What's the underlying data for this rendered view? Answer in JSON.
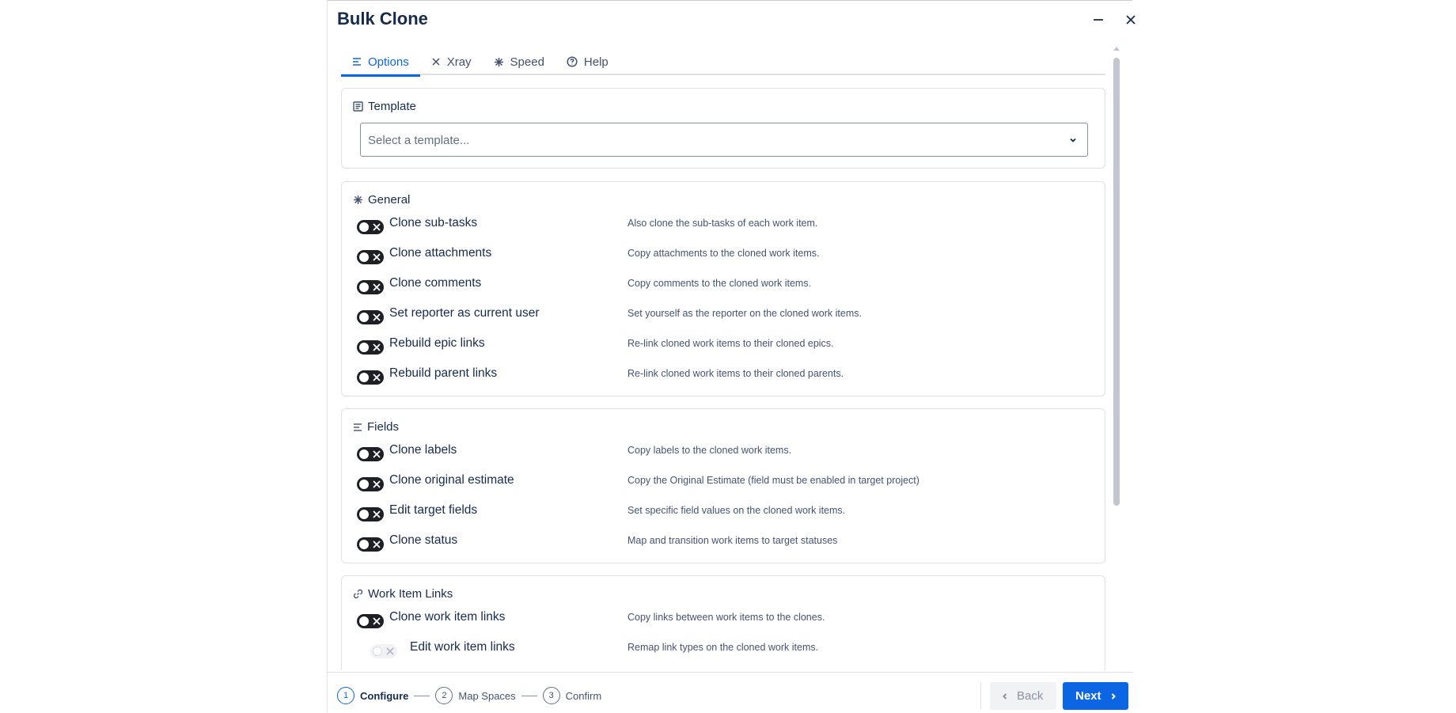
{
  "dialog": {
    "title": "Bulk Clone"
  },
  "tabs": [
    {
      "label": "Options",
      "icon": "list-icon",
      "active": true
    },
    {
      "label": "Xray",
      "icon": "close-icon",
      "active": false
    },
    {
      "label": "Speed",
      "icon": "sparkle-icon",
      "active": false
    },
    {
      "label": "Help",
      "icon": "help-icon",
      "active": false
    }
  ],
  "template": {
    "title": "Template",
    "placeholder": "Select a template..."
  },
  "general": {
    "title": "General",
    "items": [
      {
        "label": "Clone sub-tasks",
        "desc": "Also clone the sub-tasks of each work item.",
        "enabled": false
      },
      {
        "label": "Clone attachments",
        "desc": "Copy attachments to the cloned work items.",
        "enabled": false
      },
      {
        "label": "Clone comments",
        "desc": "Copy comments to the cloned work items.",
        "enabled": false
      },
      {
        "label": "Set reporter as current user",
        "desc": "Set yourself as the reporter on the cloned work items.",
        "enabled": false
      },
      {
        "label": "Rebuild epic links",
        "desc": "Re-link cloned work items to their cloned epics.",
        "enabled": false
      },
      {
        "label": "Rebuild parent links",
        "desc": "Re-link cloned work items to their cloned parents.",
        "enabled": false
      }
    ]
  },
  "fields": {
    "title": "Fields",
    "items": [
      {
        "label": "Clone labels",
        "desc": "Copy labels to the cloned work items.",
        "enabled": false
      },
      {
        "label": "Clone original estimate",
        "desc": "Copy the Original Estimate (field must be enabled in target project)",
        "enabled": false
      },
      {
        "label": "Edit target fields",
        "desc": "Set specific field values on the cloned work items.",
        "enabled": false
      },
      {
        "label": "Clone status",
        "desc": "Map and transition work items to target statuses",
        "enabled": false
      }
    ]
  },
  "links": {
    "title": "Work Item Links",
    "items": [
      {
        "label": "Clone work item links",
        "desc": "Copy links between work items to the clones.",
        "enabled": false
      },
      {
        "label": "Edit work item links",
        "desc": "Remap link types on the cloned work items.",
        "enabled": false,
        "disabled": true
      }
    ]
  },
  "footer": {
    "steps": [
      {
        "num": "1",
        "label": "Configure"
      },
      {
        "num": "2",
        "label": "Map Spaces"
      },
      {
        "num": "3",
        "label": "Confirm"
      }
    ],
    "back_label": "Back",
    "next_label": "Next"
  },
  "colors": {
    "accent": "#0c66e4",
    "toggle_off": "#1d2125"
  }
}
